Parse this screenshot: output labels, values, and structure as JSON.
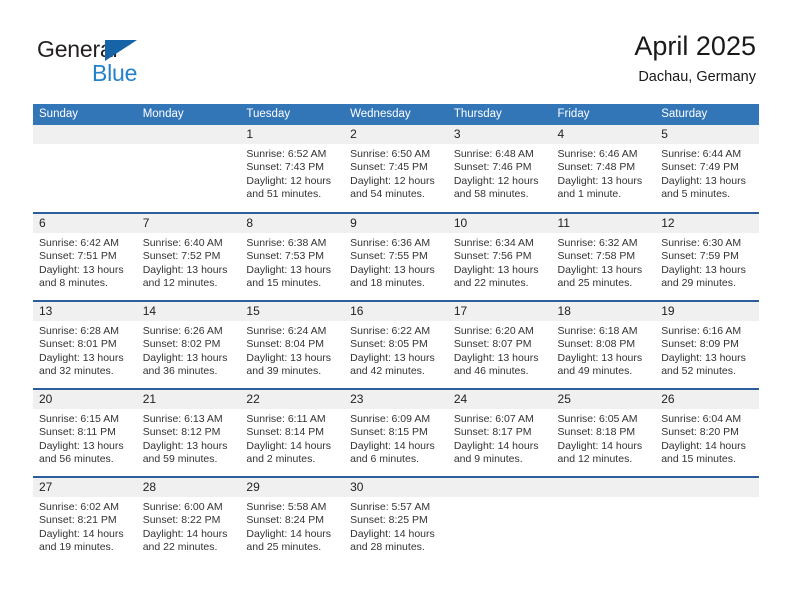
{
  "brand": {
    "name_part1": "General",
    "name_part2": "Blue",
    "triangle_icon": "triangle-icon",
    "color_dark": "#231f20",
    "color_blue": "#2382c9"
  },
  "header": {
    "title": "April 2025",
    "location": "Dachau, Germany"
  },
  "theme": {
    "header_blue": "#3276b8",
    "row_divider_blue": "#2c5f9e",
    "daynum_band": "#f0f0f0"
  },
  "day_names": [
    "Sunday",
    "Monday",
    "Tuesday",
    "Wednesday",
    "Thursday",
    "Friday",
    "Saturday"
  ],
  "weeks": [
    [
      {
        "day": "",
        "lines": []
      },
      {
        "day": "",
        "lines": []
      },
      {
        "day": "1",
        "lines": [
          "Sunrise: 6:52 AM",
          "Sunset: 7:43 PM",
          "Daylight: 12 hours",
          "and 51 minutes."
        ]
      },
      {
        "day": "2",
        "lines": [
          "Sunrise: 6:50 AM",
          "Sunset: 7:45 PM",
          "Daylight: 12 hours",
          "and 54 minutes."
        ]
      },
      {
        "day": "3",
        "lines": [
          "Sunrise: 6:48 AM",
          "Sunset: 7:46 PM",
          "Daylight: 12 hours",
          "and 58 minutes."
        ]
      },
      {
        "day": "4",
        "lines": [
          "Sunrise: 6:46 AM",
          "Sunset: 7:48 PM",
          "Daylight: 13 hours",
          "and 1 minute."
        ]
      },
      {
        "day": "5",
        "lines": [
          "Sunrise: 6:44 AM",
          "Sunset: 7:49 PM",
          "Daylight: 13 hours",
          "and 5 minutes."
        ]
      }
    ],
    [
      {
        "day": "6",
        "lines": [
          "Sunrise: 6:42 AM",
          "Sunset: 7:51 PM",
          "Daylight: 13 hours",
          "and 8 minutes."
        ]
      },
      {
        "day": "7",
        "lines": [
          "Sunrise: 6:40 AM",
          "Sunset: 7:52 PM",
          "Daylight: 13 hours",
          "and 12 minutes."
        ]
      },
      {
        "day": "8",
        "lines": [
          "Sunrise: 6:38 AM",
          "Sunset: 7:53 PM",
          "Daylight: 13 hours",
          "and 15 minutes."
        ]
      },
      {
        "day": "9",
        "lines": [
          "Sunrise: 6:36 AM",
          "Sunset: 7:55 PM",
          "Daylight: 13 hours",
          "and 18 minutes."
        ]
      },
      {
        "day": "10",
        "lines": [
          "Sunrise: 6:34 AM",
          "Sunset: 7:56 PM",
          "Daylight: 13 hours",
          "and 22 minutes."
        ]
      },
      {
        "day": "11",
        "lines": [
          "Sunrise: 6:32 AM",
          "Sunset: 7:58 PM",
          "Daylight: 13 hours",
          "and 25 minutes."
        ]
      },
      {
        "day": "12",
        "lines": [
          "Sunrise: 6:30 AM",
          "Sunset: 7:59 PM",
          "Daylight: 13 hours",
          "and 29 minutes."
        ]
      }
    ],
    [
      {
        "day": "13",
        "lines": [
          "Sunrise: 6:28 AM",
          "Sunset: 8:01 PM",
          "Daylight: 13 hours",
          "and 32 minutes."
        ]
      },
      {
        "day": "14",
        "lines": [
          "Sunrise: 6:26 AM",
          "Sunset: 8:02 PM",
          "Daylight: 13 hours",
          "and 36 minutes."
        ]
      },
      {
        "day": "15",
        "lines": [
          "Sunrise: 6:24 AM",
          "Sunset: 8:04 PM",
          "Daylight: 13 hours",
          "and 39 minutes."
        ]
      },
      {
        "day": "16",
        "lines": [
          "Sunrise: 6:22 AM",
          "Sunset: 8:05 PM",
          "Daylight: 13 hours",
          "and 42 minutes."
        ]
      },
      {
        "day": "17",
        "lines": [
          "Sunrise: 6:20 AM",
          "Sunset: 8:07 PM",
          "Daylight: 13 hours",
          "and 46 minutes."
        ]
      },
      {
        "day": "18",
        "lines": [
          "Sunrise: 6:18 AM",
          "Sunset: 8:08 PM",
          "Daylight: 13 hours",
          "and 49 minutes."
        ]
      },
      {
        "day": "19",
        "lines": [
          "Sunrise: 6:16 AM",
          "Sunset: 8:09 PM",
          "Daylight: 13 hours",
          "and 52 minutes."
        ]
      }
    ],
    [
      {
        "day": "20",
        "lines": [
          "Sunrise: 6:15 AM",
          "Sunset: 8:11 PM",
          "Daylight: 13 hours",
          "and 56 minutes."
        ]
      },
      {
        "day": "21",
        "lines": [
          "Sunrise: 6:13 AM",
          "Sunset: 8:12 PM",
          "Daylight: 13 hours",
          "and 59 minutes."
        ]
      },
      {
        "day": "22",
        "lines": [
          "Sunrise: 6:11 AM",
          "Sunset: 8:14 PM",
          "Daylight: 14 hours",
          "and 2 minutes."
        ]
      },
      {
        "day": "23",
        "lines": [
          "Sunrise: 6:09 AM",
          "Sunset: 8:15 PM",
          "Daylight: 14 hours",
          "and 6 minutes."
        ]
      },
      {
        "day": "24",
        "lines": [
          "Sunrise: 6:07 AM",
          "Sunset: 8:17 PM",
          "Daylight: 14 hours",
          "and 9 minutes."
        ]
      },
      {
        "day": "25",
        "lines": [
          "Sunrise: 6:05 AM",
          "Sunset: 8:18 PM",
          "Daylight: 14 hours",
          "and 12 minutes."
        ]
      },
      {
        "day": "26",
        "lines": [
          "Sunrise: 6:04 AM",
          "Sunset: 8:20 PM",
          "Daylight: 14 hours",
          "and 15 minutes."
        ]
      }
    ],
    [
      {
        "day": "27",
        "lines": [
          "Sunrise: 6:02 AM",
          "Sunset: 8:21 PM",
          "Daylight: 14 hours",
          "and 19 minutes."
        ]
      },
      {
        "day": "28",
        "lines": [
          "Sunrise: 6:00 AM",
          "Sunset: 8:22 PM",
          "Daylight: 14 hours",
          "and 22 minutes."
        ]
      },
      {
        "day": "29",
        "lines": [
          "Sunrise: 5:58 AM",
          "Sunset: 8:24 PM",
          "Daylight: 14 hours",
          "and 25 minutes."
        ]
      },
      {
        "day": "30",
        "lines": [
          "Sunrise: 5:57 AM",
          "Sunset: 8:25 PM",
          "Daylight: 14 hours",
          "and 28 minutes."
        ]
      },
      {
        "day": "",
        "lines": []
      },
      {
        "day": "",
        "lines": []
      },
      {
        "day": "",
        "lines": []
      }
    ]
  ]
}
